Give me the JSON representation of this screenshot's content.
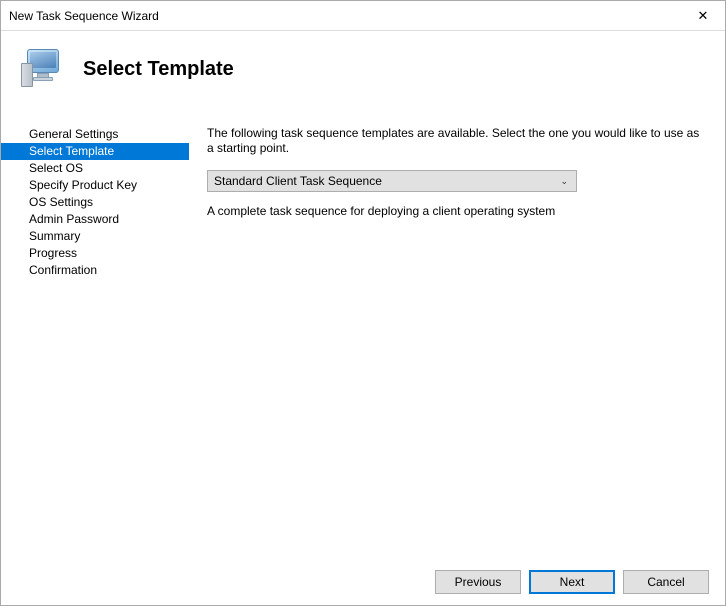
{
  "window": {
    "title": "New Task Sequence Wizard"
  },
  "header": {
    "title": "Select Template"
  },
  "sidebar": {
    "items": [
      {
        "label": "General Settings"
      },
      {
        "label": "Select Template"
      },
      {
        "label": "Select OS"
      },
      {
        "label": "Specify Product Key"
      },
      {
        "label": "OS Settings"
      },
      {
        "label": "Admin Password"
      },
      {
        "label": "Summary"
      },
      {
        "label": "Progress"
      },
      {
        "label": "Confirmation"
      }
    ],
    "selectedIndex": 1
  },
  "main": {
    "instruction": "The following task sequence templates are available.  Select the one you would like to use as a starting point.",
    "dropdown": {
      "selected": "Standard Client Task Sequence"
    },
    "description": "A complete task sequence for deploying a client operating system"
  },
  "footer": {
    "previous": "Previous",
    "next": "Next",
    "cancel": "Cancel"
  }
}
